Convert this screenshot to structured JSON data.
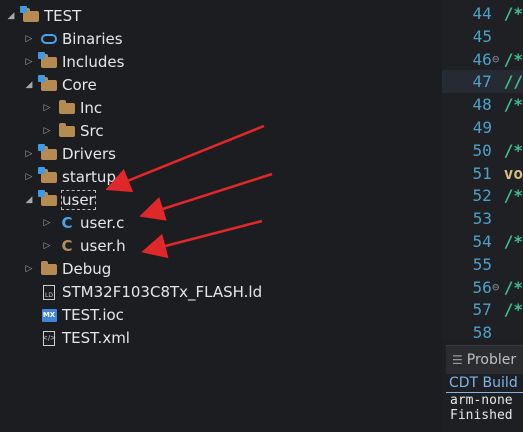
{
  "project_tree": {
    "items": [
      {
        "label": "TEST",
        "icon": "project-folder-icon",
        "expanded": true
      },
      {
        "label": "Binaries",
        "icon": "binaries-icon",
        "expanded": false
      },
      {
        "label": "Includes",
        "icon": "includes-folder-icon",
        "expanded": false
      },
      {
        "label": "Core",
        "icon": "source-folder-icon",
        "expanded": true
      },
      {
        "label": "Inc",
        "icon": "folder-icon",
        "expanded": false
      },
      {
        "label": "Src",
        "icon": "folder-icon",
        "expanded": false
      },
      {
        "label": "Drivers",
        "icon": "source-folder-icon",
        "expanded": false
      },
      {
        "label": "startup",
        "icon": "source-folder-icon",
        "expanded": false
      },
      {
        "label": "user",
        "icon": "source-folder-icon",
        "expanded": true
      },
      {
        "label": "user.c",
        "icon": "c-source-file-icon",
        "expanded": false
      },
      {
        "label": "user.h",
        "icon": "c-header-file-icon",
        "expanded": false
      },
      {
        "label": "Debug",
        "icon": "folder-icon",
        "expanded": false
      },
      {
        "label": "STM32F103C8Tx_FLASH.ld",
        "icon": "linker-script-icon"
      },
      {
        "label": "TEST.ioc",
        "icon": "mx-file-icon"
      },
      {
        "label": "TEST.xml",
        "icon": "xml-file-icon"
      }
    ]
  },
  "editor": {
    "lines": [
      {
        "num": "44",
        "fold": "",
        "code": "/*"
      },
      {
        "num": "45",
        "fold": "",
        "code": ""
      },
      {
        "num": "46",
        "fold": "⊖",
        "code": "/*"
      },
      {
        "num": "47",
        "fold": "",
        "code": "//"
      },
      {
        "num": "48",
        "fold": "",
        "code": "/*"
      },
      {
        "num": "49",
        "fold": "",
        "code": ""
      },
      {
        "num": "50",
        "fold": "",
        "code": "/*"
      },
      {
        "num": "51",
        "fold": "",
        "code": "vo"
      },
      {
        "num": "52",
        "fold": "",
        "code": "/*"
      },
      {
        "num": "53",
        "fold": "",
        "code": ""
      },
      {
        "num": "54",
        "fold": "",
        "code": "/*"
      },
      {
        "num": "55",
        "fold": "",
        "code": ""
      },
      {
        "num": "56",
        "fold": "⊖",
        "code": "/*"
      },
      {
        "num": "57",
        "fold": "",
        "code": "/*"
      },
      {
        "num": "58",
        "fold": "",
        "code": ""
      }
    ]
  },
  "bottom_panel": {
    "tab_label": "Probler",
    "console_title": "CDT Build",
    "console_lines": [
      "arm-none",
      "Finished"
    ]
  },
  "colors": {
    "arrow": "#e0282b",
    "folder": "#b58b52",
    "accent": "#4aa3e8"
  }
}
